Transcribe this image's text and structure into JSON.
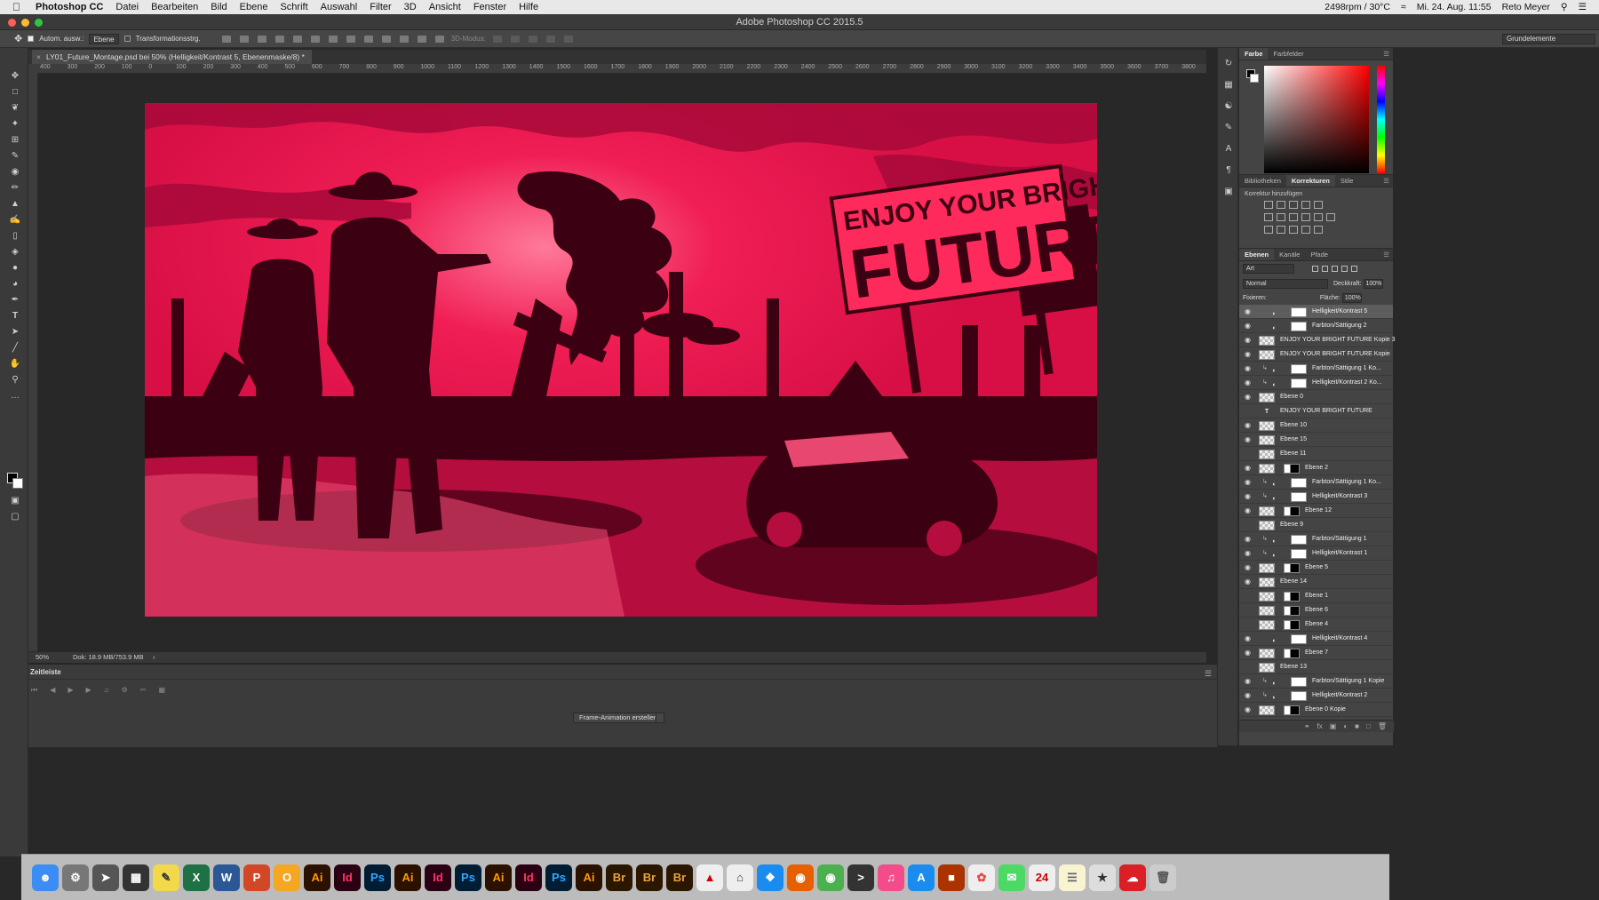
{
  "menubar": {
    "app": "Photoshop CC",
    "items": [
      "Datei",
      "Bearbeiten",
      "Bild",
      "Ebene",
      "Schrift",
      "Auswahl",
      "Filter",
      "3D",
      "Ansicht",
      "Fenster",
      "Hilfe"
    ],
    "fan": "2498rpm / 30°C",
    "clock": "Mi. 24. Aug. 11:55",
    "user": "Reto Meyer"
  },
  "window_title": "Adobe Photoshop CC 2015.5",
  "options": {
    "auto_select_label": "Autom. ausw.:",
    "auto_select_value": "Ebene",
    "transform_label": "Transformationsstrg.",
    "mode_3d_label": "3D-Modus:",
    "workspace": "Grundelemente"
  },
  "document": {
    "tab_title": "LY01_Future_Montage.psd bei 50% (Helligkeit/Kontrast 5, Ebenenmaske/8) *",
    "zoom": "50%",
    "doc_size": "Dok: 18.9 MB/753.9 MB"
  },
  "ruler_ticks": [
    "400",
    "300",
    "200",
    "100",
    "0",
    "100",
    "200",
    "300",
    "400",
    "500",
    "600",
    "700",
    "800",
    "900",
    "1000",
    "1100",
    "1200",
    "1300",
    "1400",
    "1500",
    "1600",
    "1700",
    "1800",
    "1900",
    "2000",
    "2100",
    "2200",
    "2300",
    "2400",
    "2500",
    "2600",
    "2700",
    "2800",
    "2900",
    "3000",
    "3100",
    "3200",
    "3300",
    "3400",
    "3500",
    "3600",
    "3700",
    "3800"
  ],
  "artwork": {
    "billboard_line1": "ENJOY YOUR BRIGHT",
    "billboard_line2": "FUTURE",
    "bg_color": "#e8104a",
    "silhouette_color": "#3b0012"
  },
  "timeline": {
    "title": "Zeitleiste",
    "create_button": "Frame-Animation erstellen"
  },
  "color_panel": {
    "tabs": [
      "Farbe",
      "Farbfelder"
    ]
  },
  "adjust_panel": {
    "tabs": [
      "Bibliotheken",
      "Korrekturen",
      "Stile"
    ],
    "heading": "Korrektur hinzufügen"
  },
  "layers_panel": {
    "tabs": [
      "Ebenen",
      "Kanäle",
      "Pfade"
    ],
    "filter": "Art",
    "blend_mode": "Normal",
    "opacity_label": "Deckkraft:",
    "opacity": "100%",
    "lock_label": "Fixieren:",
    "fill_label": "Fläche:",
    "fill": "100%",
    "layers": [
      {
        "name": "Helligkeit/Kontrast 5",
        "visible": true,
        "adj": true,
        "selected": true
      },
      {
        "name": "Farbton/Sättigung 2",
        "visible": true,
        "adj": true
      },
      {
        "name": "ENJOY YOUR BRIGHT FUTURE Kopie 3",
        "visible": true
      },
      {
        "name": "ENJOY YOUR BRIGHT FUTURE Kopie",
        "visible": true
      },
      {
        "name": "Farbton/Sättigung 1 Ko...",
        "visible": true,
        "adj": true,
        "clip": true
      },
      {
        "name": "Helligkeit/Kontrast 2 Ko...",
        "visible": true,
        "adj": true,
        "clip": true
      },
      {
        "name": "Ebene 0",
        "visible": true
      },
      {
        "name": "ENJOY YOUR BRIGHT FUTURE",
        "visible": false,
        "text": true
      },
      {
        "name": "Ebene 10",
        "visible": true
      },
      {
        "name": "Ebene 15",
        "visible": true
      },
      {
        "name": "Ebene 11",
        "visible": false
      },
      {
        "name": "Ebene 2",
        "visible": true,
        "mask": true
      },
      {
        "name": "Farbton/Sättigung 1 Ko...",
        "visible": true,
        "adj": true,
        "clip": true
      },
      {
        "name": "Helligkeit/Kontrast 3",
        "visible": true,
        "adj": true,
        "clip": true
      },
      {
        "name": "Ebene 12",
        "visible": true,
        "mask": true
      },
      {
        "name": "Ebene 9",
        "visible": false
      },
      {
        "name": "Farbton/Sättigung 1",
        "visible": true,
        "adj": true,
        "clip": true
      },
      {
        "name": "Helligkeit/Kontrast 1",
        "visible": true,
        "adj": true,
        "clip": true
      },
      {
        "name": "Ebene 5",
        "visible": true,
        "mask": true
      },
      {
        "name": "Ebene 14",
        "visible": true
      },
      {
        "name": "Ebene 1",
        "visible": false,
        "mask": true
      },
      {
        "name": "Ebene 6",
        "visible": false,
        "mask": true
      },
      {
        "name": "Ebene 4",
        "visible": false,
        "mask": true
      },
      {
        "name": "Helligkeit/Kontrast 4",
        "visible": true,
        "adj": true
      },
      {
        "name": "Ebene 7",
        "visible": true,
        "mask": true
      },
      {
        "name": "Ebene 13",
        "visible": false
      },
      {
        "name": "Farbton/Sättigung 1 Kopie",
        "visible": true,
        "adj": true,
        "clip": true
      },
      {
        "name": "Helligkeit/Kontrast 2",
        "visible": true,
        "adj": true,
        "clip": true
      },
      {
        "name": "Ebene 0 Kopie",
        "visible": true,
        "mask": true
      }
    ]
  },
  "dock": [
    "Ai",
    "Id",
    "Ps",
    "Ai",
    "Id",
    "Ps",
    "Ai",
    "Id",
    "Ps",
    "Ai",
    "Br",
    "Br",
    "Br"
  ]
}
